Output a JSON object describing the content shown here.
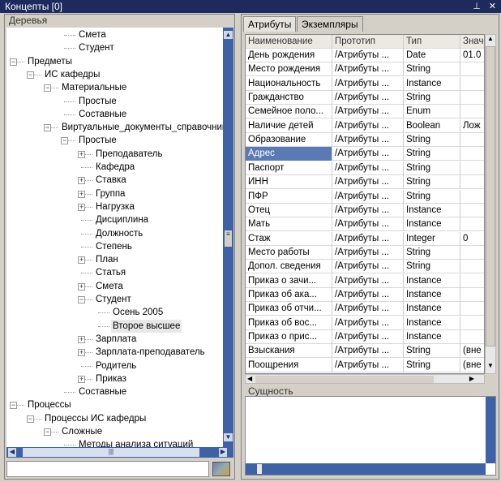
{
  "window": {
    "title": "Концепты [0]",
    "pin_icon": "pin-icon",
    "close_icon": "close-icon"
  },
  "left": {
    "header": "Деревья",
    "tree": [
      {
        "level": 3,
        "label": "Смета",
        "exp": ""
      },
      {
        "level": 3,
        "label": "Студент",
        "exp": ""
      },
      {
        "level": 0,
        "label": "Предметы",
        "exp": "-"
      },
      {
        "level": 1,
        "label": "ИС кафедры",
        "exp": "-"
      },
      {
        "level": 2,
        "label": "Материальные",
        "exp": "-"
      },
      {
        "level": 3,
        "label": "Простые",
        "exp": ""
      },
      {
        "level": 3,
        "label": "Составные",
        "exp": ""
      },
      {
        "level": 2,
        "label": "Виртуальные_документы_справочники",
        "exp": "-"
      },
      {
        "level": 3,
        "label": "Простые",
        "exp": "-"
      },
      {
        "level": 4,
        "label": "Преподаватель",
        "exp": "+"
      },
      {
        "level": 4,
        "label": "Кафедра",
        "exp": ""
      },
      {
        "level": 4,
        "label": "Ставка",
        "exp": "+"
      },
      {
        "level": 4,
        "label": "Группа",
        "exp": "+"
      },
      {
        "level": 4,
        "label": "Нагрузка",
        "exp": "+"
      },
      {
        "level": 4,
        "label": "Дисциплина",
        "exp": ""
      },
      {
        "level": 4,
        "label": "Должность",
        "exp": ""
      },
      {
        "level": 4,
        "label": "Степень",
        "exp": ""
      },
      {
        "level": 4,
        "label": "План",
        "exp": "+"
      },
      {
        "level": 4,
        "label": "Статья",
        "exp": ""
      },
      {
        "level": 4,
        "label": "Смета",
        "exp": "+"
      },
      {
        "level": 4,
        "label": "Студент",
        "exp": "-"
      },
      {
        "level": 5,
        "label": "Осень 2005",
        "exp": ""
      },
      {
        "level": 5,
        "label": "Второе высшее",
        "exp": "",
        "selected": true
      },
      {
        "level": 4,
        "label": "Зарплата",
        "exp": "+"
      },
      {
        "level": 4,
        "label": "Зарплата-преподаватель",
        "exp": "+"
      },
      {
        "level": 4,
        "label": "Родитель",
        "exp": ""
      },
      {
        "level": 4,
        "label": "Приказ",
        "exp": "+"
      },
      {
        "level": 3,
        "label": "Составные",
        "exp": ""
      },
      {
        "level": 0,
        "label": "Процессы",
        "exp": "-"
      },
      {
        "level": 1,
        "label": "Процессы ИС кафедры",
        "exp": "-"
      },
      {
        "level": 2,
        "label": "Сложные",
        "exp": "-"
      },
      {
        "level": 3,
        "label": "Методы анализа ситуаций",
        "exp": ""
      }
    ],
    "search_value": ""
  },
  "right": {
    "tabs": [
      "Атрибуты",
      "Экземпляры"
    ],
    "columns": [
      "Наименование",
      "Прототип",
      "Тип",
      "Значение"
    ],
    "rows": [
      [
        "День рождения",
        "/Атрибуты ...",
        "Date",
        "01.0"
      ],
      [
        "Место рождения",
        "/Атрибуты ...",
        "String",
        ""
      ],
      [
        "Национальность",
        "/Атрибуты ...",
        "Instance",
        ""
      ],
      [
        "Гражданство",
        "/Атрибуты ...",
        "String",
        ""
      ],
      [
        "Семейное поло...",
        "/Атрибуты ...",
        "Enum",
        ""
      ],
      [
        "Наличие детей",
        "/Атрибуты ...",
        "Boolean",
        "Лож"
      ],
      [
        "Образование",
        "/Атрибуты ...",
        "String",
        ""
      ],
      [
        "Адрес",
        "/Атрибуты ...",
        "String",
        ""
      ],
      [
        "Паспорт",
        "/Атрибуты ...",
        "String",
        ""
      ],
      [
        "ИНН",
        "/Атрибуты ...",
        "String",
        ""
      ],
      [
        "ПФР",
        "/Атрибуты ...",
        "String",
        ""
      ],
      [
        "Отец",
        "/Атрибуты ...",
        "Instance",
        ""
      ],
      [
        "Мать",
        "/Атрибуты ...",
        "Instance",
        ""
      ],
      [
        "Стаж",
        "/Атрибуты ...",
        "Integer",
        "0"
      ],
      [
        "Место работы",
        "/Атрибуты ...",
        "String",
        ""
      ],
      [
        "Допол. сведения",
        "/Атрибуты ...",
        "String",
        ""
      ],
      [
        "Приказ о зачи...",
        "/Атрибуты ...",
        "Instance",
        ""
      ],
      [
        "Приказ об ака...",
        "/Атрибуты ...",
        "Instance",
        ""
      ],
      [
        "Приказ об отчи...",
        "/Атрибуты ...",
        "Instance",
        ""
      ],
      [
        "Приказ об вос...",
        "/Атрибуты ...",
        "Instance",
        ""
      ],
      [
        "Приказ о прис...",
        "/Атрибуты ...",
        "Instance",
        ""
      ],
      [
        "Взыскания",
        "/Атрибуты ...",
        "String",
        "(вне"
      ],
      [
        "Поощрения",
        "/Атрибуты ...",
        "String",
        "(вне"
      ]
    ],
    "selected_row": 7,
    "entity_label": "Сущность"
  }
}
